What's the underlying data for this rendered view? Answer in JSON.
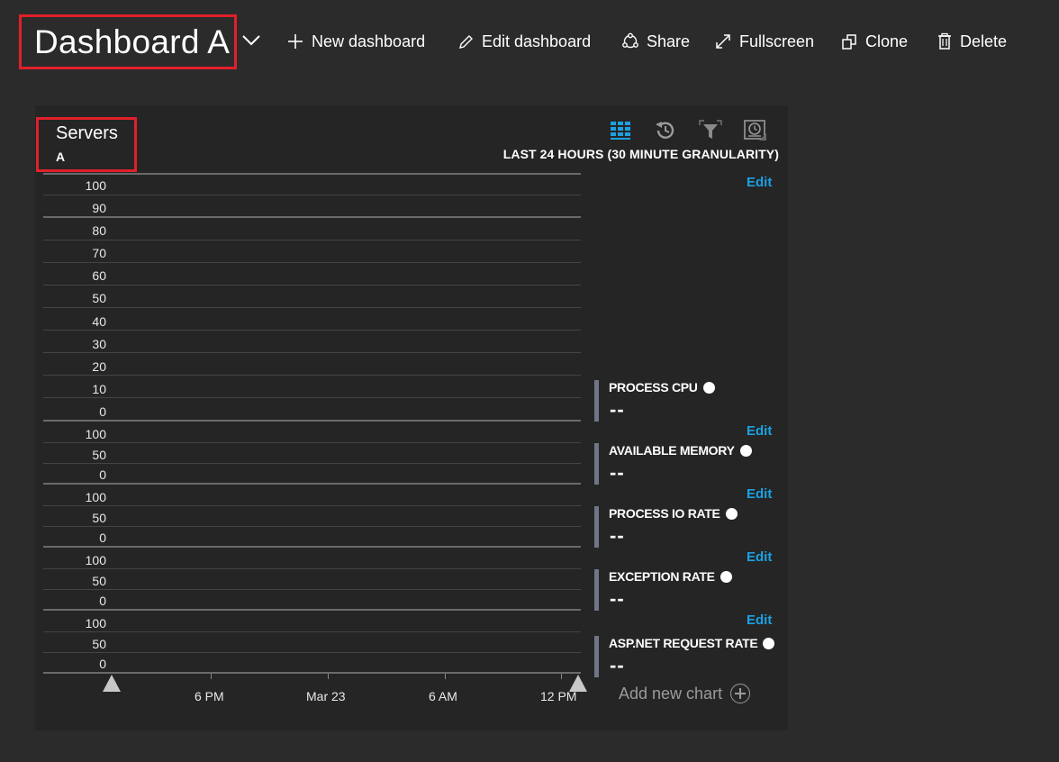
{
  "header": {
    "title": "Dashboard A",
    "toolbar": [
      {
        "label": "New dashboard",
        "icon": "plus-icon"
      },
      {
        "label": "Edit dashboard",
        "icon": "pencil-icon"
      },
      {
        "label": "Share",
        "icon": "share-icon"
      },
      {
        "label": "Fullscreen",
        "icon": "expand-icon"
      },
      {
        "label": "Clone",
        "icon": "clone-icon"
      },
      {
        "label": "Delete",
        "icon": "trash-icon"
      }
    ]
  },
  "tile": {
    "title": "Servers",
    "subtitle": "A",
    "time_range": "LAST 24 HOURS (30 MINUTE GRANULARITY)",
    "tools": [
      "grid-icon",
      "history-icon",
      "filter-icon",
      "clock-icon"
    ],
    "top_edit": "Edit",
    "y_ticks_main": [
      "100",
      "90",
      "80",
      "70",
      "60",
      "50",
      "40",
      "30",
      "20",
      "10",
      "0"
    ],
    "y_ticks_small": [
      "100",
      "50",
      "0"
    ],
    "x_ticks": [
      "6 PM",
      "Mar 23",
      "6 AM",
      "12 PM"
    ],
    "metrics": [
      {
        "name": "PROCESS CPU",
        "value": "--",
        "edit": "Edit"
      },
      {
        "name": "AVAILABLE MEMORY",
        "value": "--",
        "edit": "Edit"
      },
      {
        "name": "PROCESS IO RATE",
        "value": "--",
        "edit": "Edit"
      },
      {
        "name": "EXCEPTION RATE",
        "value": "--",
        "edit": "Edit"
      },
      {
        "name": "ASP.NET REQUEST RATE",
        "value": "--"
      }
    ],
    "add_chart": "Add new chart",
    "accent_color": "#1ba1e2",
    "highlight_color": "#e0202a"
  }
}
